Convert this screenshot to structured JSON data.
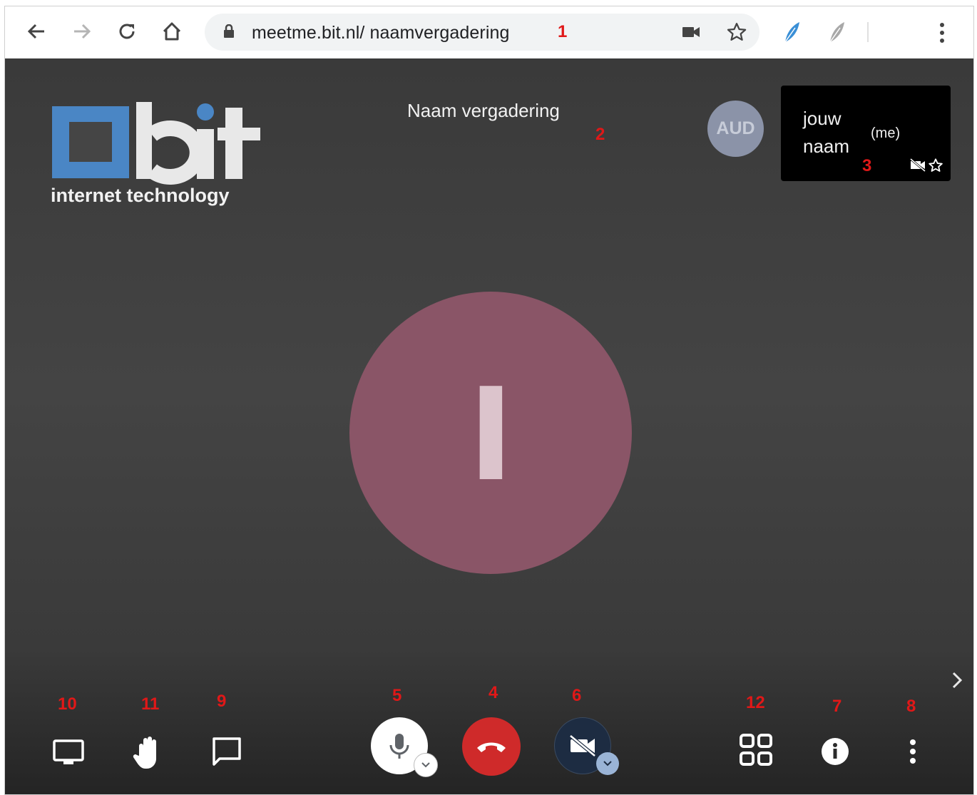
{
  "browser": {
    "url": "meetme.bit.nl/ naamvergadering",
    "back_icon": "arrow-left-icon",
    "forward_icon": "arrow-right-icon",
    "reload_icon": "reload-icon",
    "home_icon": "home-icon",
    "lock_icon": "lock-icon",
    "camera_icon": "camera-icon",
    "star_icon": "star-icon",
    "menu_icon": "kebab-menu-icon"
  },
  "logo": {
    "name": "bit",
    "tagline": "internet technology",
    "color": "#4a86c5"
  },
  "meeting": {
    "title": "Naam vergadering"
  },
  "participants": {
    "aud_label": "AUD",
    "self_name": "jouw naam",
    "self_tag": "(me)"
  },
  "main_avatar": {
    "initial": "I",
    "color": "#8a5567"
  },
  "annotations": [
    "1",
    "2",
    "3",
    "4",
    "5",
    "6",
    "7",
    "8",
    "9",
    "10",
    "11",
    "12"
  ],
  "colors": {
    "hangup": "#cf2a2a",
    "annotation": "#e01818",
    "stage": "#3f3f3f"
  }
}
